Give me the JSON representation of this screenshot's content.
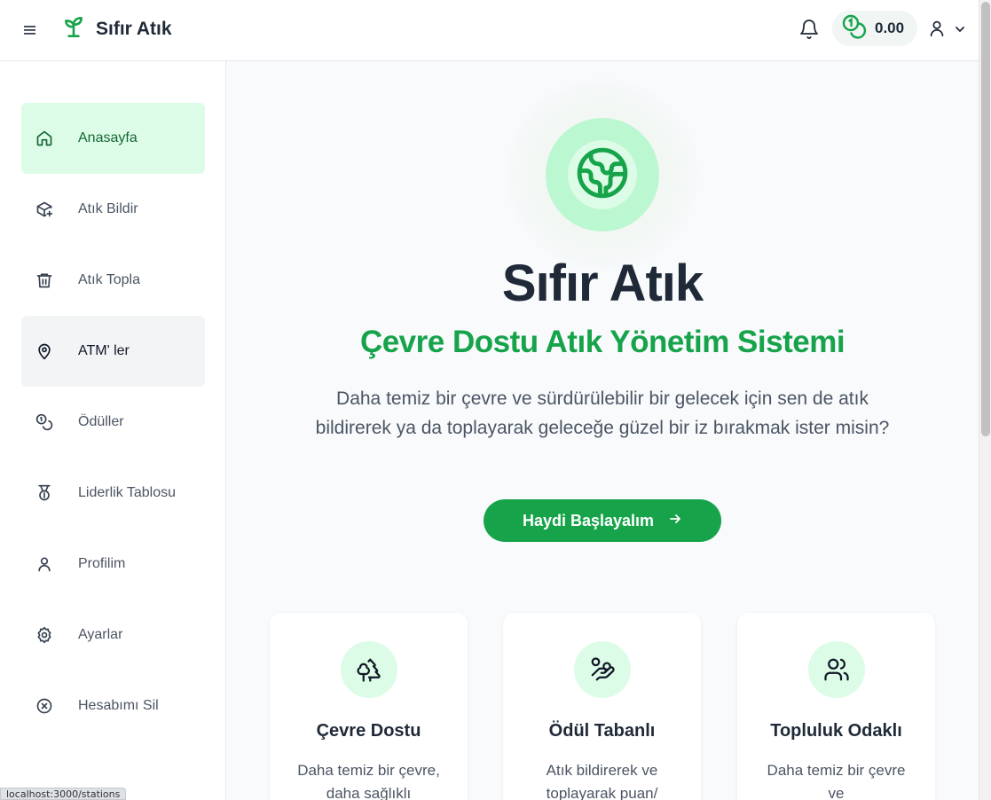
{
  "header": {
    "app_name": "Sıfır Atık",
    "balance": "0.00",
    "icons": {
      "menu": "hamburger-icon",
      "logo": "sprout-icon",
      "bell": "bell-icon",
      "coins": "coins-icon",
      "user": "user-icon",
      "chevron": "chevron-down-icon"
    }
  },
  "sidebar": {
    "items": [
      {
        "label": "Anasayfa",
        "icon": "home-icon",
        "state": "active"
      },
      {
        "label": "Atık Bildir",
        "icon": "package-plus-icon"
      },
      {
        "label": "Atık Topla",
        "icon": "trash-icon"
      },
      {
        "label": "ATM' ler",
        "icon": "map-pin-icon",
        "state": "hover"
      },
      {
        "label": "Ödüller",
        "icon": "coins-icon"
      },
      {
        "label": "Liderlik Tablosu",
        "icon": "medal-icon"
      },
      {
        "label": "Profilim",
        "icon": "user-icon"
      },
      {
        "label": "Ayarlar",
        "icon": "settings-icon"
      },
      {
        "label": "Hesabımı Sil",
        "icon": "x-circle-icon"
      }
    ]
  },
  "hero": {
    "title": "Sıfır Atık",
    "subtitle": "Çevre Dostu Atık Yönetim Sistemi",
    "description": "Daha temiz bir çevre ve sürdürülebilir bir gelecek için sen de atık bildirerek ya da toplayarak geleceğe güzel bir iz bırakmak ister misin?",
    "cta_label": "Haydi Başlayalım",
    "icon": "globe-icon"
  },
  "features": [
    {
      "title": "Çevre Dostu",
      "text": "Daha temiz bir çevre, daha sağlıklı",
      "icon": "trees-icon"
    },
    {
      "title": "Ödül Tabanlı",
      "text": "Atık bildirerek ve toplayarak puan/",
      "icon": "hand-coins-icon"
    },
    {
      "title": "Topluluk Odaklı",
      "text": "Daha temiz bir çevre ve",
      "icon": "users-icon"
    }
  ],
  "status_bar": {
    "url": "localhost:3000/stations"
  },
  "colors": {
    "accent": "#16a34a",
    "active_bg": "#dcfce7",
    "icon_circle": "#bbf7d0"
  }
}
